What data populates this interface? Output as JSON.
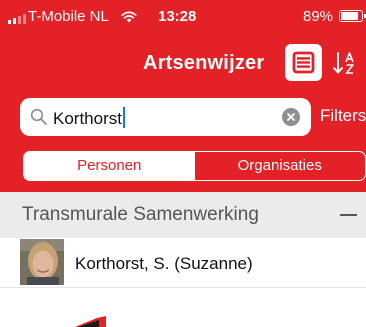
{
  "status_bar": {
    "carrier": "T-Mobile NL",
    "time": "13:28",
    "battery": "89%",
    "battery_level": 0.89,
    "signal_icon": "signal-bars-icon",
    "wifi_icon": "wifi-icon"
  },
  "nav": {
    "title": "Artsenwijzer",
    "menu_icon": "menu-list-icon",
    "sort_icon": "sort-az-icon"
  },
  "search": {
    "value": "Korthorst",
    "search_icon": "search-icon",
    "clear_icon": "clear-icon",
    "filters_label": "Filters"
  },
  "segments": [
    {
      "label": "Personen",
      "active": true
    },
    {
      "label": "Organisaties",
      "active": false
    }
  ],
  "section": {
    "title": "Transmurale Samenwerking",
    "collapse_icon": "minus-icon"
  },
  "results": [
    {
      "name": "Korthorst, S. (Suzanne)"
    }
  ],
  "colors": {
    "brand_red": "#e32127",
    "section_bg": "#ebebeb"
  }
}
